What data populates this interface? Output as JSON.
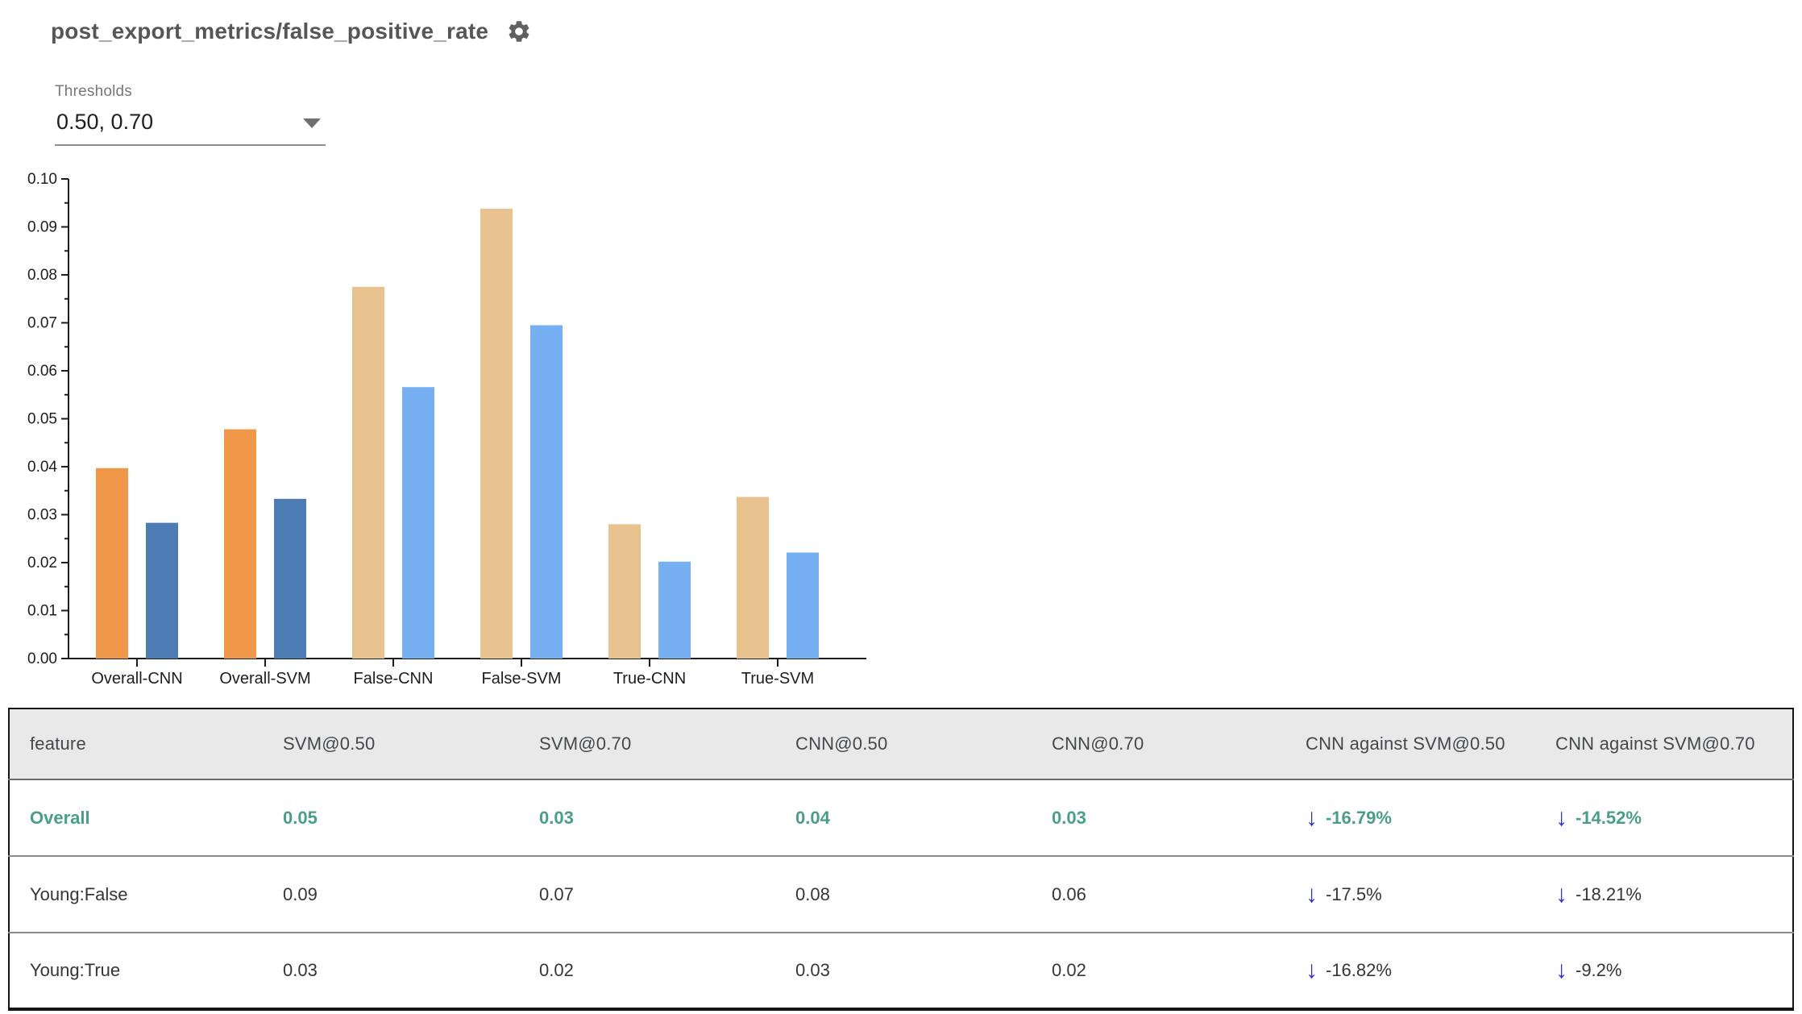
{
  "header": {
    "title": "post_export_metrics/false_positive_rate"
  },
  "thresholds": {
    "label": "Thresholds",
    "value": "0.50, 0.70"
  },
  "icons": {
    "down_arrow": "↓",
    "gear": "settings-gear",
    "dropdown_caret": "caret-down"
  },
  "colors": {
    "bar_t50_highlight": "#ef9849",
    "bar_t70_highlight": "#4d7cb5",
    "bar_t50_faded": "#e8c28f",
    "bar_t70_faded": "#76aff2",
    "highlight_row_green": "#4a9e88",
    "delta_arrow_blue": "#2a2ae2",
    "header_bg": "#e9e9e9"
  },
  "chart_data": {
    "type": "bar",
    "title": "post_export_metrics/false_positive_rate",
    "categories": [
      "Overall-CNN",
      "Overall-SVM",
      "False-CNN",
      "False-SVM",
      "True-CNN",
      "True-SVM"
    ],
    "series": [
      {
        "name": "threshold 0.50",
        "values": [
          0.0397,
          0.0478,
          0.0775,
          0.0938,
          0.028,
          0.0337
        ]
      },
      {
        "name": "threshold 0.70",
        "values": [
          0.0283,
          0.0333,
          0.0566,
          0.0695,
          0.0202,
          0.0221
        ]
      }
    ],
    "highlighted_categories": [
      "Overall-CNN",
      "Overall-SVM"
    ],
    "xlabel": "",
    "ylabel": "",
    "ylim": [
      0,
      0.1
    ],
    "y_tick_step": 0.01,
    "y_minor_tick_step": 0.005,
    "y_tick_labels": [
      "0.00",
      "0.01",
      "0.02",
      "0.03",
      "0.04",
      "0.05",
      "0.06",
      "0.07",
      "0.08",
      "0.09",
      "0.10"
    ],
    "grid": false,
    "legend": "none"
  },
  "table": {
    "columns": [
      "feature",
      "SVM@0.50",
      "SVM@0.70",
      "CNN@0.50",
      "CNN@0.70",
      "CNN against SVM@0.50",
      "CNN against SVM@0.70"
    ],
    "rows": [
      {
        "cells": [
          "Overall",
          "0.05",
          "0.03",
          "0.04",
          "0.03",
          "-16.79%",
          "-14.52%"
        ],
        "highlight": true
      },
      {
        "cells": [
          "Young:False",
          "0.09",
          "0.07",
          "0.08",
          "0.06",
          "-17.5%",
          "-18.21%"
        ],
        "highlight": false
      },
      {
        "cells": [
          "Young:True",
          "0.03",
          "0.02",
          "0.03",
          "0.02",
          "-16.82%",
          "-9.2%"
        ],
        "highlight": false
      }
    ]
  }
}
